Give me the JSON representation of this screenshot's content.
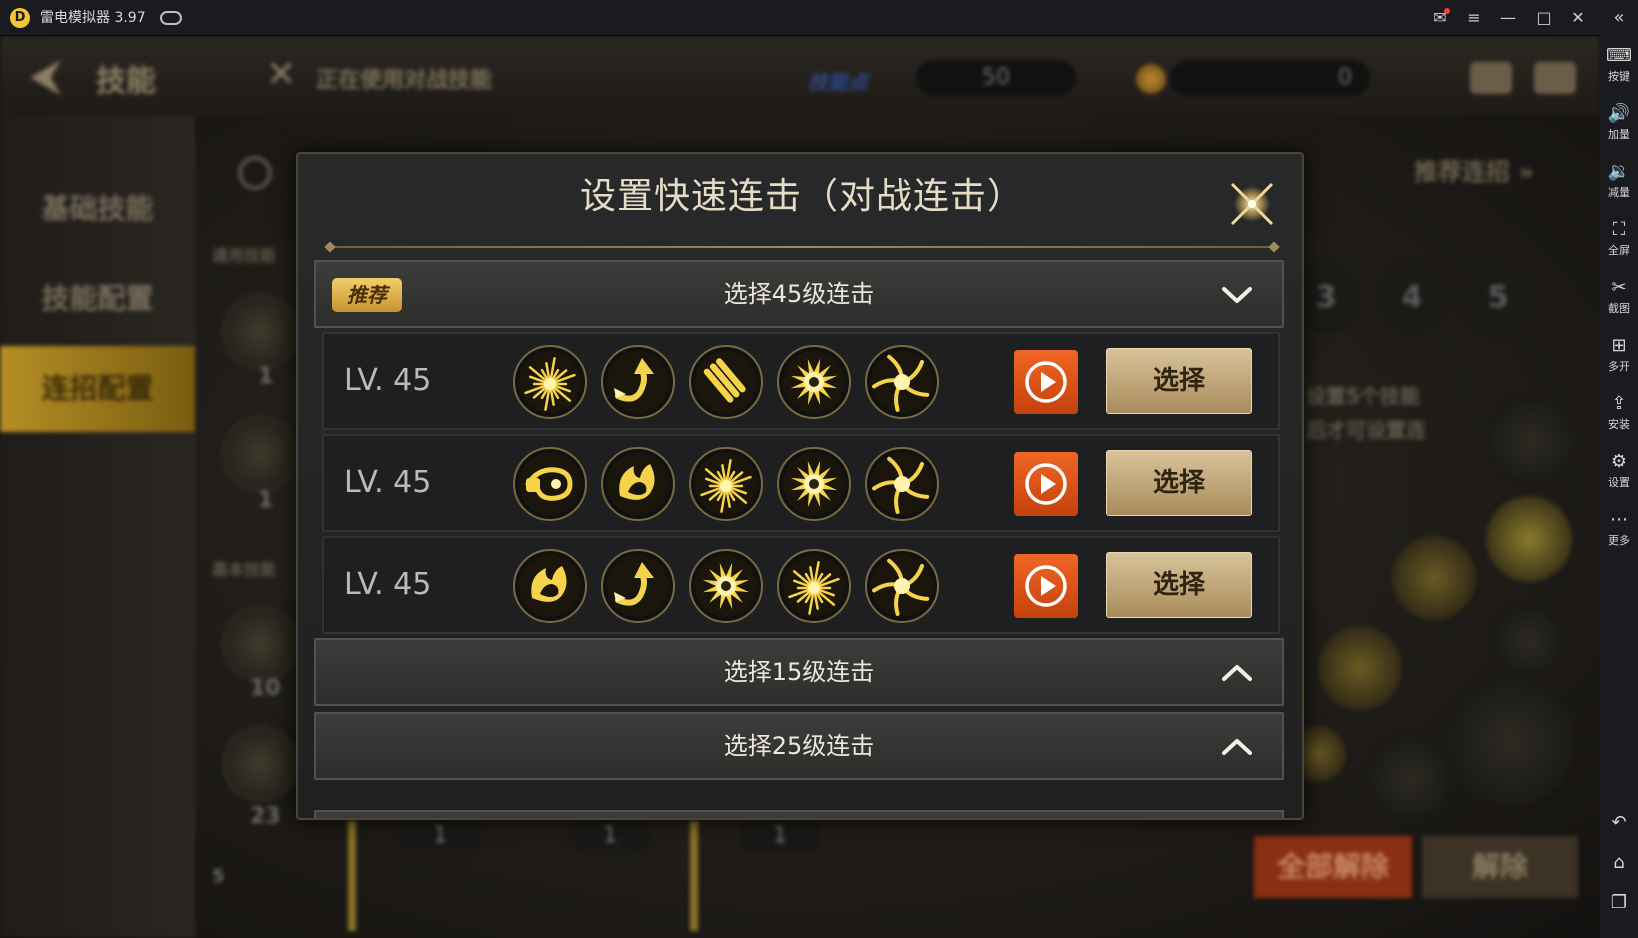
{
  "emulator": {
    "logo_glyph": "D",
    "title": "雷电模拟器 3.97",
    "controls": {
      "mail": "✉",
      "menu": "≡",
      "minimize": "—",
      "maximize": "□",
      "close": "✕",
      "collapse": "«"
    },
    "toolbar": [
      {
        "icon": "⌨",
        "label": "按键",
        "icon_name": "keyboard-icon"
      },
      {
        "icon": "🔊",
        "label": "加量",
        "icon_name": "volume-up-icon"
      },
      {
        "icon": "🔉",
        "label": "减量",
        "icon_name": "volume-down-icon"
      },
      {
        "icon": "⛶",
        "label": "全屏",
        "icon_name": "fullscreen-icon"
      },
      {
        "icon": "✂",
        "label": "截图",
        "icon_name": "screenshot-icon"
      },
      {
        "icon": "⊞",
        "label": "多开",
        "icon_name": "multi-instance-icon"
      },
      {
        "icon": "⇪",
        "label": "安装",
        "icon_name": "install-apk-icon"
      },
      {
        "icon": "⚙",
        "label": "设置",
        "icon_name": "settings-icon"
      },
      {
        "icon": "⋯",
        "label": "更多",
        "icon_name": "more-icon"
      }
    ],
    "bottom_buttons": [
      {
        "icon": "↶",
        "icon_name": "back-icon"
      },
      {
        "icon": "⌂",
        "icon_name": "home-icon"
      },
      {
        "icon": "❐",
        "icon_name": "recent-apps-icon"
      }
    ]
  },
  "background": {
    "back_glyph": "⮜",
    "title": "技能",
    "cross_glyph": "✕",
    "using_label": "正在使用对战技能",
    "skill_points_label": "技能点",
    "skill_points": "50",
    "coins": "0",
    "nav": [
      "基础技能",
      "技能配置",
      "连招配置"
    ],
    "nav_active_index": 2,
    "sub_label_1": "通用技能",
    "sub_label_2": "基本技能",
    "skill_counts": [
      "1",
      "1",
      "10",
      "23"
    ],
    "slot_numbers": [
      "1",
      "1",
      "1"
    ],
    "recommend_label": "推荐连招",
    "recommend_glyph": "»",
    "circle_numbers": [
      "3",
      "4",
      "5"
    ],
    "hint_lines": [
      "设置5个技能",
      "后才可设置连"
    ],
    "footer_count": "5",
    "clear_all_label": "全部解除",
    "release_label": "解除"
  },
  "modal": {
    "title": "设置快速连击（对战连击）",
    "close_glyph": "✕",
    "sections": [
      {
        "title": "选择45级连击",
        "badge": "推荐",
        "expanded": true
      },
      {
        "title": "选择15级连击",
        "badge": "",
        "expanded": false
      },
      {
        "title": "选择25级连击",
        "badge": "",
        "expanded": false
      }
    ],
    "combos": [
      {
        "level": "LV. 45",
        "skills": [
          "burst-skill-icon",
          "uppercut-arrow-skill-icon",
          "bullets-skill-icon",
          "radiant-sun-skill-icon",
          "vortex-skill-icon"
        ],
        "select_label": "选择"
      },
      {
        "level": "LV. 45",
        "skills": [
          "dragon-punch-skill-icon",
          "flame-claw-skill-icon",
          "burst-skill-icon",
          "radiant-sun-skill-icon",
          "vortex-skill-icon"
        ],
        "select_label": "选择"
      },
      {
        "level": "LV. 45",
        "skills": [
          "flame-claw-skill-icon",
          "uppercut-arrow-skill-icon",
          "radiant-sun-skill-icon",
          "burst-skill-icon",
          "vortex-skill-icon"
        ],
        "select_label": "选择"
      }
    ]
  },
  "colors": {
    "accent_orange": "#e25a1c",
    "gold": "#d9b34a",
    "select_button": "#c3aa7c",
    "badge": "#e7b44e"
  }
}
